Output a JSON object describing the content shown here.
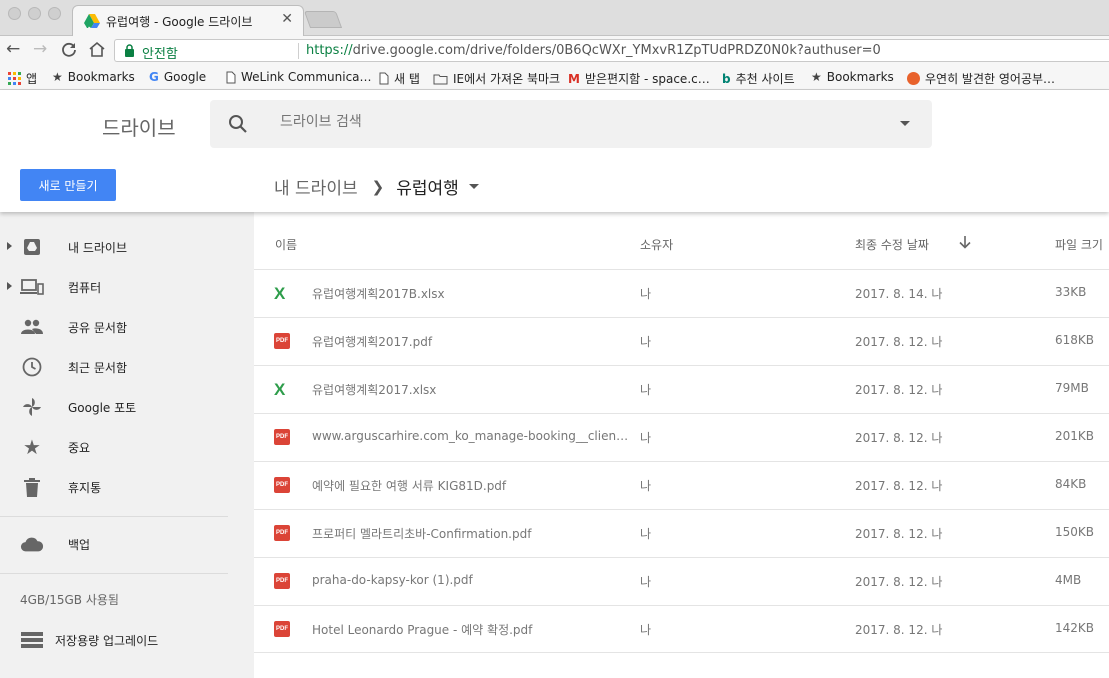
{
  "browser": {
    "tab_title": "유럽여행 - Google 드라이브",
    "secure_label": "안전함",
    "url_scheme": "https://",
    "url_rest": "drive.google.com/drive/folders/0B6QcWXr_YMxvR1ZpTUdPRDZ0N0k?authuser=0"
  },
  "bookmarks": [
    {
      "label": "앱",
      "icon": "apps-grid-icon"
    },
    {
      "label": "Bookmarks",
      "icon": "star-icon"
    },
    {
      "label": "Google",
      "icon": "google-g-icon"
    },
    {
      "label": "WeLink Communica…",
      "icon": "page-icon"
    },
    {
      "label": "새 탭",
      "icon": "page-icon"
    },
    {
      "label": "IE에서 가져온 북마크",
      "icon": "folder-icon"
    },
    {
      "label": "받은편지함 - space.c…",
      "icon": "gmail-icon"
    },
    {
      "label": "추천 사이트",
      "icon": "bing-icon"
    },
    {
      "label": "Bookmarks",
      "icon": "star-icon"
    },
    {
      "label": "우연히 발견한 영어공부…",
      "icon": "site-icon"
    }
  ],
  "drive": {
    "logo_text": "드라이브",
    "search_placeholder": "드라이브 검색",
    "new_button": "새로 만들기",
    "breadcrumb_root": "내 드라이브",
    "breadcrumb_current": "유럽여행"
  },
  "sidebar": {
    "items": [
      {
        "label": "내 드라이브",
        "icon": "my-drive-icon"
      },
      {
        "label": "컴퓨터",
        "icon": "computers-icon"
      },
      {
        "label": "공유 문서함",
        "icon": "shared-people-icon"
      },
      {
        "label": "최근 문서함",
        "icon": "clock-icon"
      },
      {
        "label": "Google 포토",
        "icon": "pinwheel-icon"
      },
      {
        "label": "중요",
        "icon": "star-icon"
      },
      {
        "label": "휴지통",
        "icon": "trash-icon"
      }
    ],
    "backup": "백업",
    "storage_used": "4GB/15GB 사용됨",
    "upgrade": "저장용량 업그레이드"
  },
  "table": {
    "headers": {
      "name": "이름",
      "owner": "소유자",
      "modified": "최종 수정 날짜",
      "size": "파일 크기"
    },
    "rows": [
      {
        "type": "xlsx",
        "name": "유럽여행계획2017B.xlsx",
        "owner": "나",
        "modified": "2017. 8. 14. 나",
        "size": "33KB"
      },
      {
        "type": "pdf",
        "name": "유럽여행계획2017.pdf",
        "owner": "나",
        "modified": "2017. 8. 12. 나",
        "size": "618KB"
      },
      {
        "type": "xlsx",
        "name": "유럽여행계획2017.xlsx",
        "owner": "나",
        "modified": "2017. 8. 12. 나",
        "size": "79MB"
      },
      {
        "type": "pdf",
        "name": "www.arguscarhire.com_ko_manage-booking__clienti…",
        "owner": "나",
        "modified": "2017. 8. 12. 나",
        "size": "201KB"
      },
      {
        "type": "pdf",
        "name": "예약에 필요한 여행 서류 KIG81D.pdf",
        "owner": "나",
        "modified": "2017. 8. 12. 나",
        "size": "84KB"
      },
      {
        "type": "pdf",
        "name": "프로퍼티 멜라트리초바-Confirmation.pdf",
        "owner": "나",
        "modified": "2017. 8. 12. 나",
        "size": "150KB"
      },
      {
        "type": "pdf",
        "name": "praha-do-kapsy-kor (1).pdf",
        "owner": "나",
        "modified": "2017. 8. 12. 나",
        "size": "4MB"
      },
      {
        "type": "pdf",
        "name": "Hotel Leonardo Prague - 예약 확정.pdf",
        "owner": "나",
        "modified": "2017. 8. 12. 나",
        "size": "142KB"
      }
    ]
  },
  "colors": {
    "accent": "#4285f4",
    "secure_green": "#0b8043",
    "xlsx_green": "#2e9d4b",
    "pdf_red": "#db4437",
    "sidebar_bg": "#f1f1f1"
  }
}
